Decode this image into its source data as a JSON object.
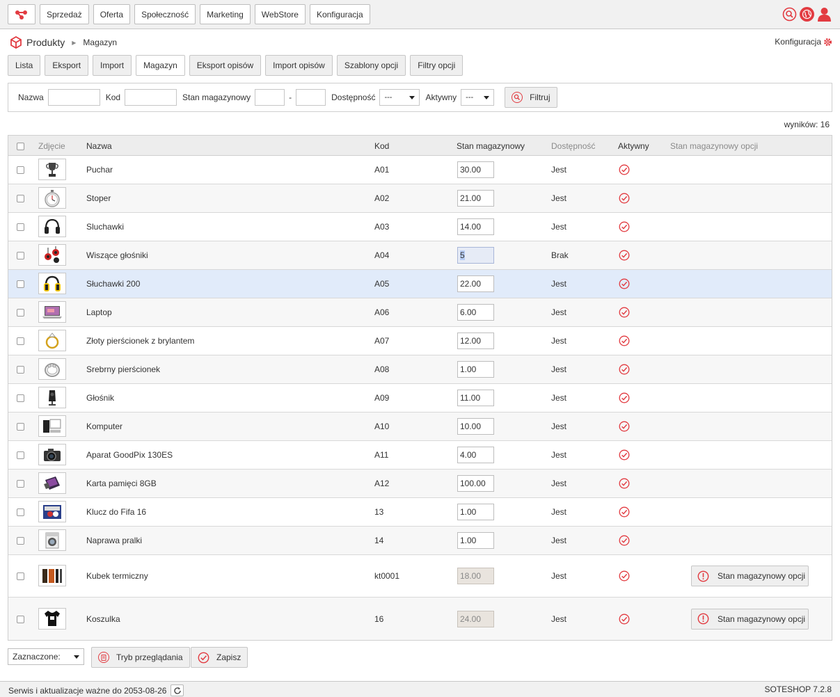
{
  "topnav": [
    "Sprzedaż",
    "Oferta",
    "Społeczność",
    "Marketing",
    "WebStore",
    "Konfiguracja"
  ],
  "breadcrumb": {
    "title": "Produkty",
    "sub": "Magazyn"
  },
  "config_link": "Konfiguracja",
  "subtabs": [
    {
      "label": "Lista",
      "active": false
    },
    {
      "label": "Eksport",
      "active": false
    },
    {
      "label": "Import",
      "active": false
    },
    {
      "label": "Magazyn",
      "active": true
    },
    {
      "label": "Eksport opisów",
      "active": false
    },
    {
      "label": "Import opisów",
      "active": false
    },
    {
      "label": "Szablony opcji",
      "active": false
    },
    {
      "label": "Filtry opcji",
      "active": false
    }
  ],
  "filter": {
    "name_label": "Nazwa",
    "code_label": "Kod",
    "stock_label": "Stan magazynowy",
    "range_sep": "-",
    "availability_label": "Dostępność",
    "availability_value": "---",
    "active_label": "Aktywny",
    "active_value": "---",
    "button": "Filtruj"
  },
  "results": "wyników: 16",
  "columns": {
    "photo": "Zdjęcie",
    "name": "Nazwa",
    "code": "Kod",
    "stock": "Stan magazynowy",
    "availability": "Dostępność",
    "active": "Aktywny",
    "option_stock": "Stan magazynowy opcji"
  },
  "rows": [
    {
      "name": "Puchar",
      "code": "A01",
      "stock": "30.00",
      "availability": "Jest",
      "thumb": "trophy-icon"
    },
    {
      "name": "Stoper",
      "code": "A02",
      "stock": "21.00",
      "availability": "Jest",
      "thumb": "stopwatch-icon"
    },
    {
      "name": "Sluchawki",
      "code": "A03",
      "stock": "14.00",
      "availability": "Jest",
      "thumb": "headphones-icon"
    },
    {
      "name": "Wiszące głośniki",
      "code": "A04",
      "stock": "5",
      "availability": "Brak",
      "thumb": "speakers-icon"
    },
    {
      "name": "Słuchawki 200",
      "code": "A05",
      "stock": "22.00",
      "availability": "Jest",
      "thumb": "headphones-yellow-icon"
    },
    {
      "name": "Laptop",
      "code": "A06",
      "stock": "6.00",
      "availability": "Jest",
      "thumb": "laptop-icon"
    },
    {
      "name": "Złoty pierścionek z brylantem",
      "code": "A07",
      "stock": "12.00",
      "availability": "Jest",
      "thumb": "gold-ring-icon"
    },
    {
      "name": "Srebrny pierścionek",
      "code": "A08",
      "stock": "1.00",
      "availability": "Jest",
      "thumb": "silver-ring-icon"
    },
    {
      "name": "Głośnik",
      "code": "A09",
      "stock": "11.00",
      "availability": "Jest",
      "thumb": "speaker-icon"
    },
    {
      "name": "Komputer",
      "code": "A10",
      "stock": "10.00",
      "availability": "Jest",
      "thumb": "computer-icon"
    },
    {
      "name": "Aparat GoodPix 130ES",
      "code": "A11",
      "stock": "4.00",
      "availability": "Jest",
      "thumb": "camera-icon"
    },
    {
      "name": "Karta pamięci 8GB",
      "code": "A12",
      "stock": "100.00",
      "availability": "Jest",
      "thumb": "memory-card-icon"
    },
    {
      "name": "Klucz do Fifa 16",
      "code": "13",
      "stock": "1.00",
      "availability": "Jest",
      "thumb": "game-cover-icon"
    },
    {
      "name": "Naprawa pralki",
      "code": "14",
      "stock": "1.00",
      "availability": "Jest",
      "thumb": "washing-machine-icon"
    },
    {
      "name": "Kubek termiczny",
      "code": "kt0001",
      "stock": "18.00",
      "availability": "Jest",
      "thumb": "thermal-mug-icon",
      "option_button": "Stan magazynowy opcji"
    },
    {
      "name": "Koszulka",
      "code": "16",
      "stock": "24.00",
      "availability": "Jest",
      "thumb": "tshirt-icon",
      "option_button": "Stan magazynowy opcji"
    }
  ],
  "bottom": {
    "selected_label": "Zaznaczone:",
    "browse_button": "Tryb przeglądania",
    "save_button": "Zapisz"
  },
  "footer": {
    "left": "Serwis i aktualizacje ważne do 2053-08-26",
    "right": "SOTESHOP 7.2.8"
  },
  "colors": {
    "accent": "#e23b41",
    "highlight_row": "#e1ebfa"
  }
}
